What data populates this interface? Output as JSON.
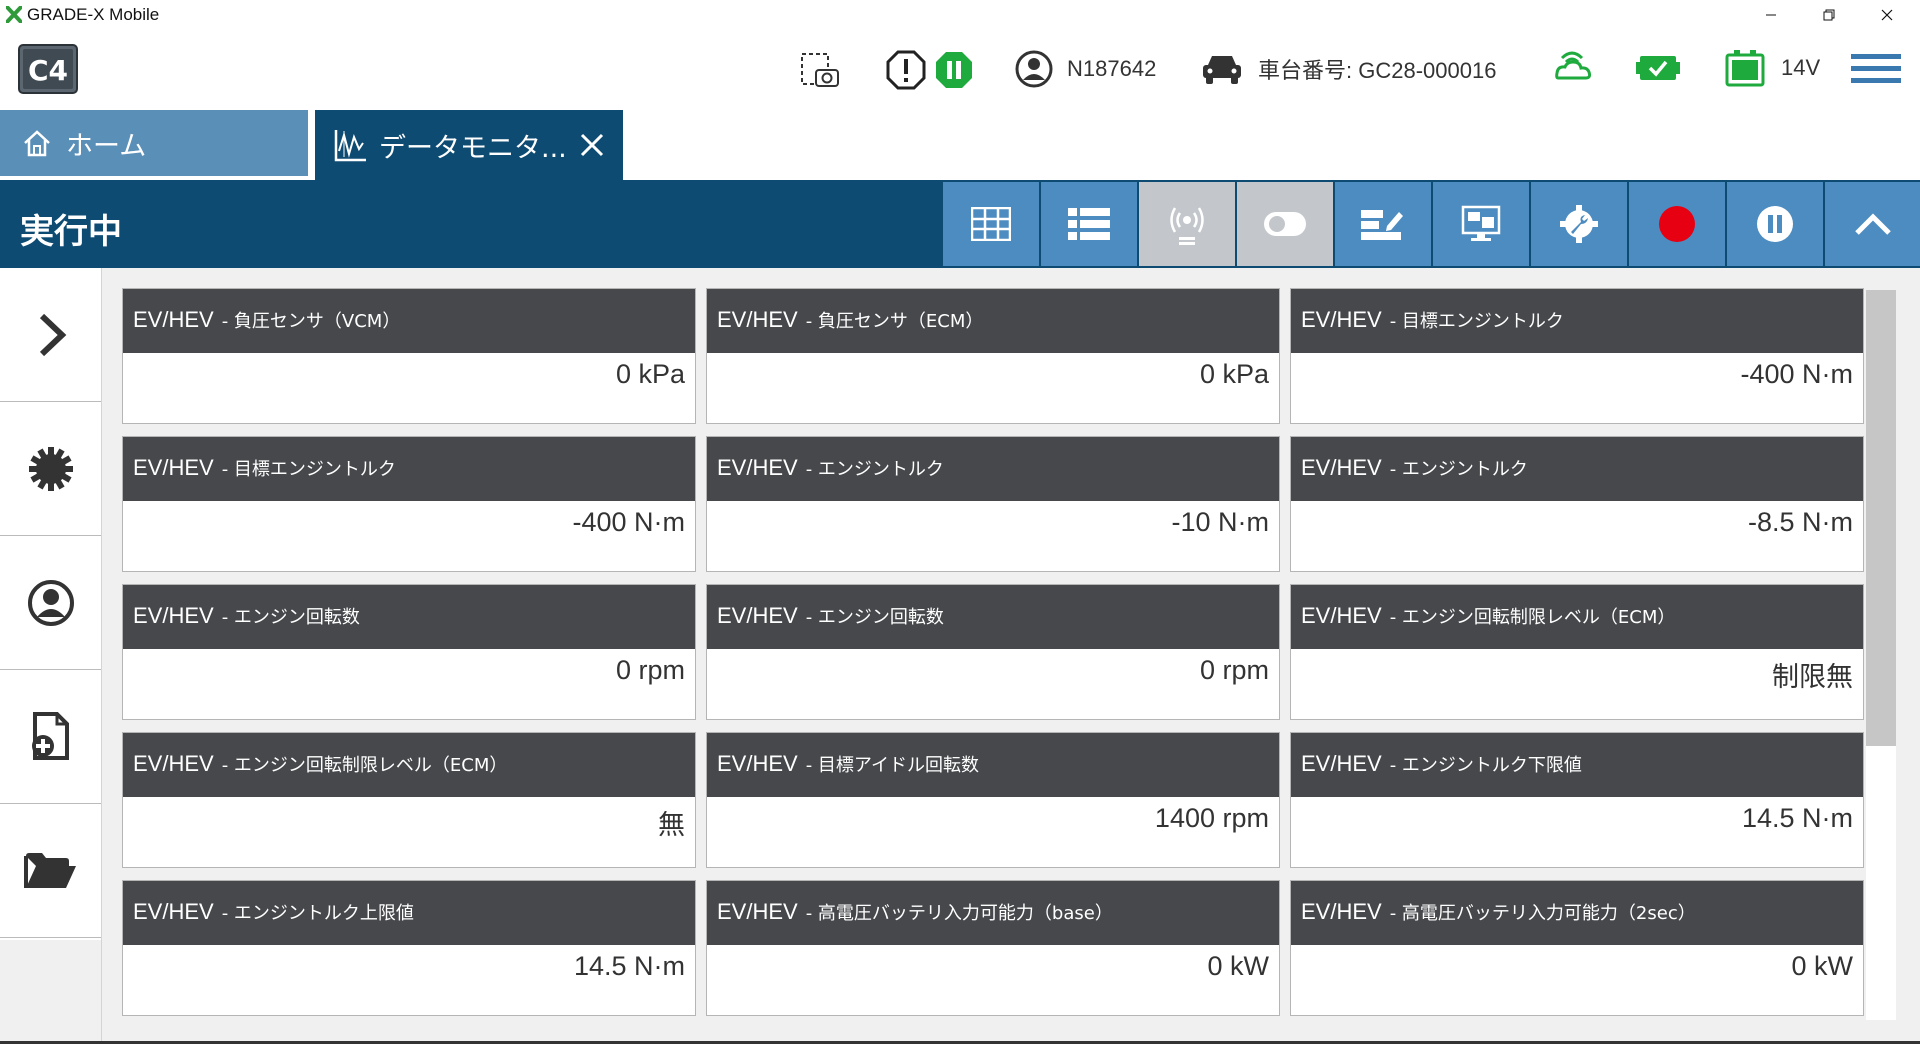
{
  "window": {
    "title": "GRADE-X Mobile",
    "controls": [
      "minimize",
      "restore",
      "close"
    ]
  },
  "header": {
    "logo": "C4",
    "user_id": "N187642",
    "vehicle_label": "車台番号: GC28-000016",
    "voltage": "14V",
    "icons": [
      "screenshot-icon",
      "warning-icon",
      "pause-status-icon",
      "user-icon",
      "car-icon",
      "wireless-icon",
      "battery-check-icon",
      "battery-icon",
      "menu-icon"
    ]
  },
  "tabs": [
    {
      "label": "ホーム",
      "active": false
    },
    {
      "label": "データモニタ...",
      "active": true
    }
  ],
  "toolbar": {
    "status": "実行中",
    "buttons": [
      "grid-view",
      "list-view",
      "signal",
      "toggle",
      "edit",
      "display",
      "settings",
      "record",
      "pause",
      "collapse"
    ],
    "accent": "#4d8cc0",
    "dark": "#0d4b73"
  },
  "sidebar": {
    "items": [
      "expand",
      "settings",
      "user",
      "new-file",
      "open-folder"
    ]
  },
  "cards": [
    {
      "category": "EV/HEV",
      "param": "- 負圧センサ（VCM）",
      "value": "0 kPa"
    },
    {
      "category": "EV/HEV",
      "param": "- 負圧センサ（ECM）",
      "value": "0 kPa"
    },
    {
      "category": "EV/HEV",
      "param": "- 目標エンジントルク",
      "value": "-400 N·m"
    },
    {
      "category": "EV/HEV",
      "param": "- 目標エンジントルク",
      "value": "-400 N·m"
    },
    {
      "category": "EV/HEV",
      "param": "- エンジントルク",
      "value": "-10 N·m"
    },
    {
      "category": "EV/HEV",
      "param": "- エンジントルク",
      "value": "-8.5 N·m"
    },
    {
      "category": "EV/HEV",
      "param": "- エンジン回転数",
      "value": "0 rpm"
    },
    {
      "category": "EV/HEV",
      "param": "- エンジン回転数",
      "value": "0 rpm"
    },
    {
      "category": "EV/HEV",
      "param": "- エンジン回転制限レベル（ECM）",
      "value": "制限無"
    },
    {
      "category": "EV/HEV",
      "param": "- エンジン回転制限レベル（ECM）",
      "value": "無"
    },
    {
      "category": "EV/HEV",
      "param": "- 目標アイドル回転数",
      "value": "1400 rpm"
    },
    {
      "category": "EV/HEV",
      "param": "- エンジントルク下限値",
      "value": "14.5 N·m"
    },
    {
      "category": "EV/HEV",
      "param": "- エンジントルク上限値",
      "value": "14.5 N·m"
    },
    {
      "category": "EV/HEV",
      "param": "- 高電圧バッテリ入力可能力（base）",
      "value": "0 kW"
    },
    {
      "category": "EV/HEV",
      "param": "- 高電圧バッテリ入力可能力（2sec）",
      "value": "0 kW"
    }
  ]
}
